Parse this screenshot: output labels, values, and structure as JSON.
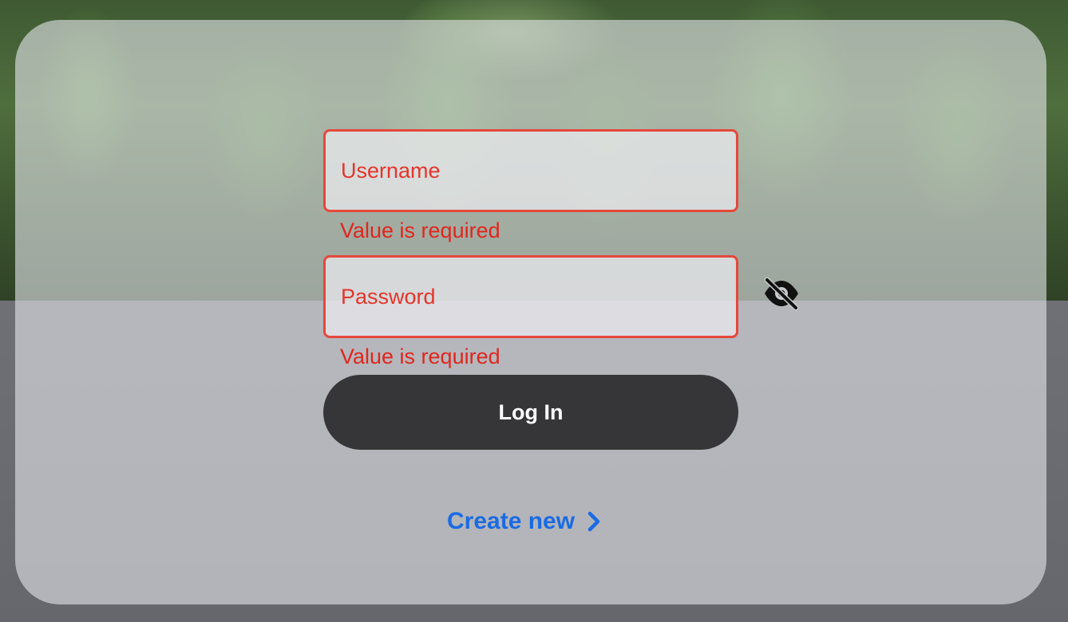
{
  "login_form": {
    "username": {
      "placeholder": "Username",
      "value": "",
      "error": "Value is required"
    },
    "password": {
      "placeholder": "Password",
      "value": "",
      "error": "Value is required",
      "visibility_icon": "eye-off-icon"
    },
    "login_button_label": "Log In",
    "create_new_label": "Create new",
    "create_new_icon": "chevron-right-icon"
  },
  "colors": {
    "error": "#e0261d",
    "field_border": "#e5483c",
    "button_bg": "#363638",
    "link": "#1a6be3"
  }
}
